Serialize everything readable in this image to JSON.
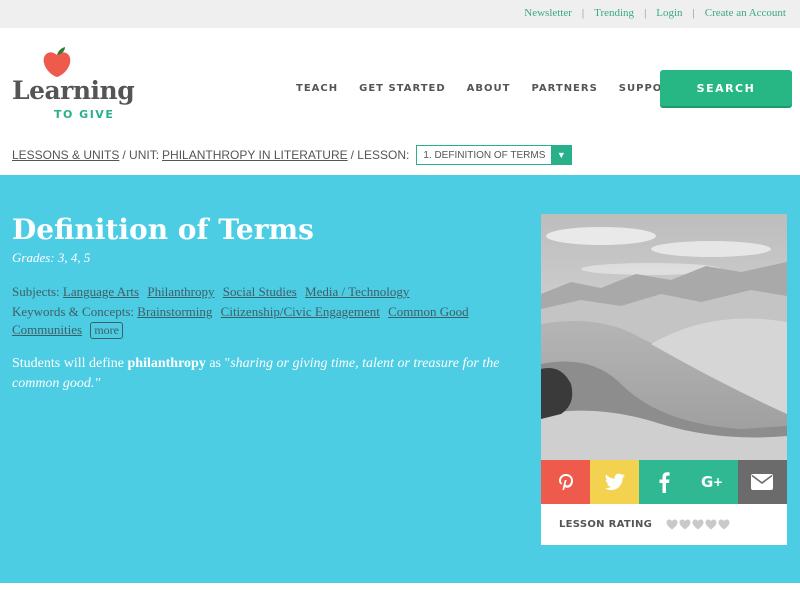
{
  "utility_links": [
    "Newsletter",
    "Trending",
    "Login",
    "Create an Account"
  ],
  "logo": {
    "word": "Learning",
    "sub": "TO GIVE"
  },
  "nav": [
    "TEACH",
    "GET STARTED",
    "ABOUT",
    "PARTNERS",
    "SUPPORT US"
  ],
  "search_label": "SEARCH",
  "breadcrumb": {
    "lessons": "LESSONS & UNITS",
    "unit_prefix": "/ UNIT:",
    "unit": "PHILANTHROPY IN LITERATURE",
    "lesson_prefix": "/ LESSON:",
    "lesson_select": "1. DEFINITION OF TERMS"
  },
  "lesson": {
    "title": "Definition of Terms",
    "grades": "Grades: 3, 4, 5",
    "subjects_label": "Subjects:",
    "subjects": [
      "Language Arts",
      "Philanthropy",
      "Social Studies",
      "Media / Technology"
    ],
    "keywords_label": "Keywords & Concepts:",
    "keywords": [
      "Brainstorming",
      "Citizenship/Civic Engagement",
      "Common Good Communities"
    ],
    "more_label": "more",
    "desc_pre": "Students will define ",
    "desc_term": "philanthropy",
    "desc_mid": " as \"",
    "desc_quote": "sharing or giving time, talent or treasure for the common good.",
    "desc_end": "\""
  },
  "share_icons": [
    "pinterest-icon",
    "twitter-icon",
    "facebook-icon",
    "google-plus-icon",
    "email-icon"
  ],
  "rating_label": "LESSON RATING",
  "rating_value": 0,
  "rating_max": 5,
  "colors": {
    "hero": "#4ccde4",
    "accent": "#27b784",
    "pinterest": "#ee5a4c",
    "twitter": "#f2d24e",
    "facebook": "#2fb892",
    "google": "#2fb892",
    "email": "#6b6b6b"
  }
}
